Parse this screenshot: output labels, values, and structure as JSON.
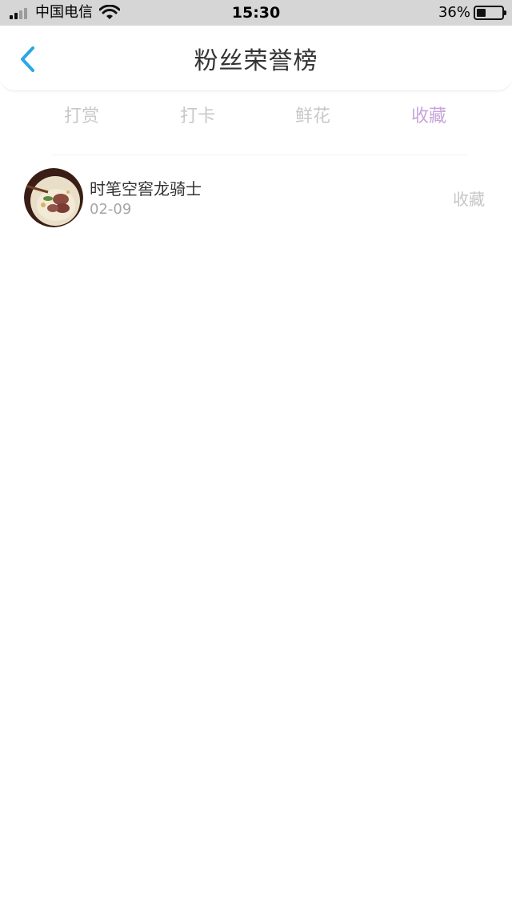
{
  "status_bar": {
    "carrier": "中国电信",
    "time": "15:30",
    "battery_percent": "36%",
    "battery_level": 0.36,
    "icons": [
      "signal-icon",
      "wifi-icon",
      "battery-icon"
    ]
  },
  "header": {
    "title": "粉丝荣誉榜",
    "back_icon": "chevron-left-icon"
  },
  "tabs": [
    {
      "label": "打赏",
      "active": false
    },
    {
      "label": "打卡",
      "active": false
    },
    {
      "label": "鲜花",
      "active": false
    },
    {
      "label": "收藏",
      "active": true
    }
  ],
  "list": [
    {
      "name": "时笔空窖龙骑士",
      "date": "02-09",
      "type": "收藏"
    }
  ],
  "colors": {
    "status_bar_bg": "#d6d6d6",
    "accent_tab": "#c8a4db",
    "inactive_tab": "#c8c8c8",
    "back_arrow": "#2aa7e6"
  }
}
